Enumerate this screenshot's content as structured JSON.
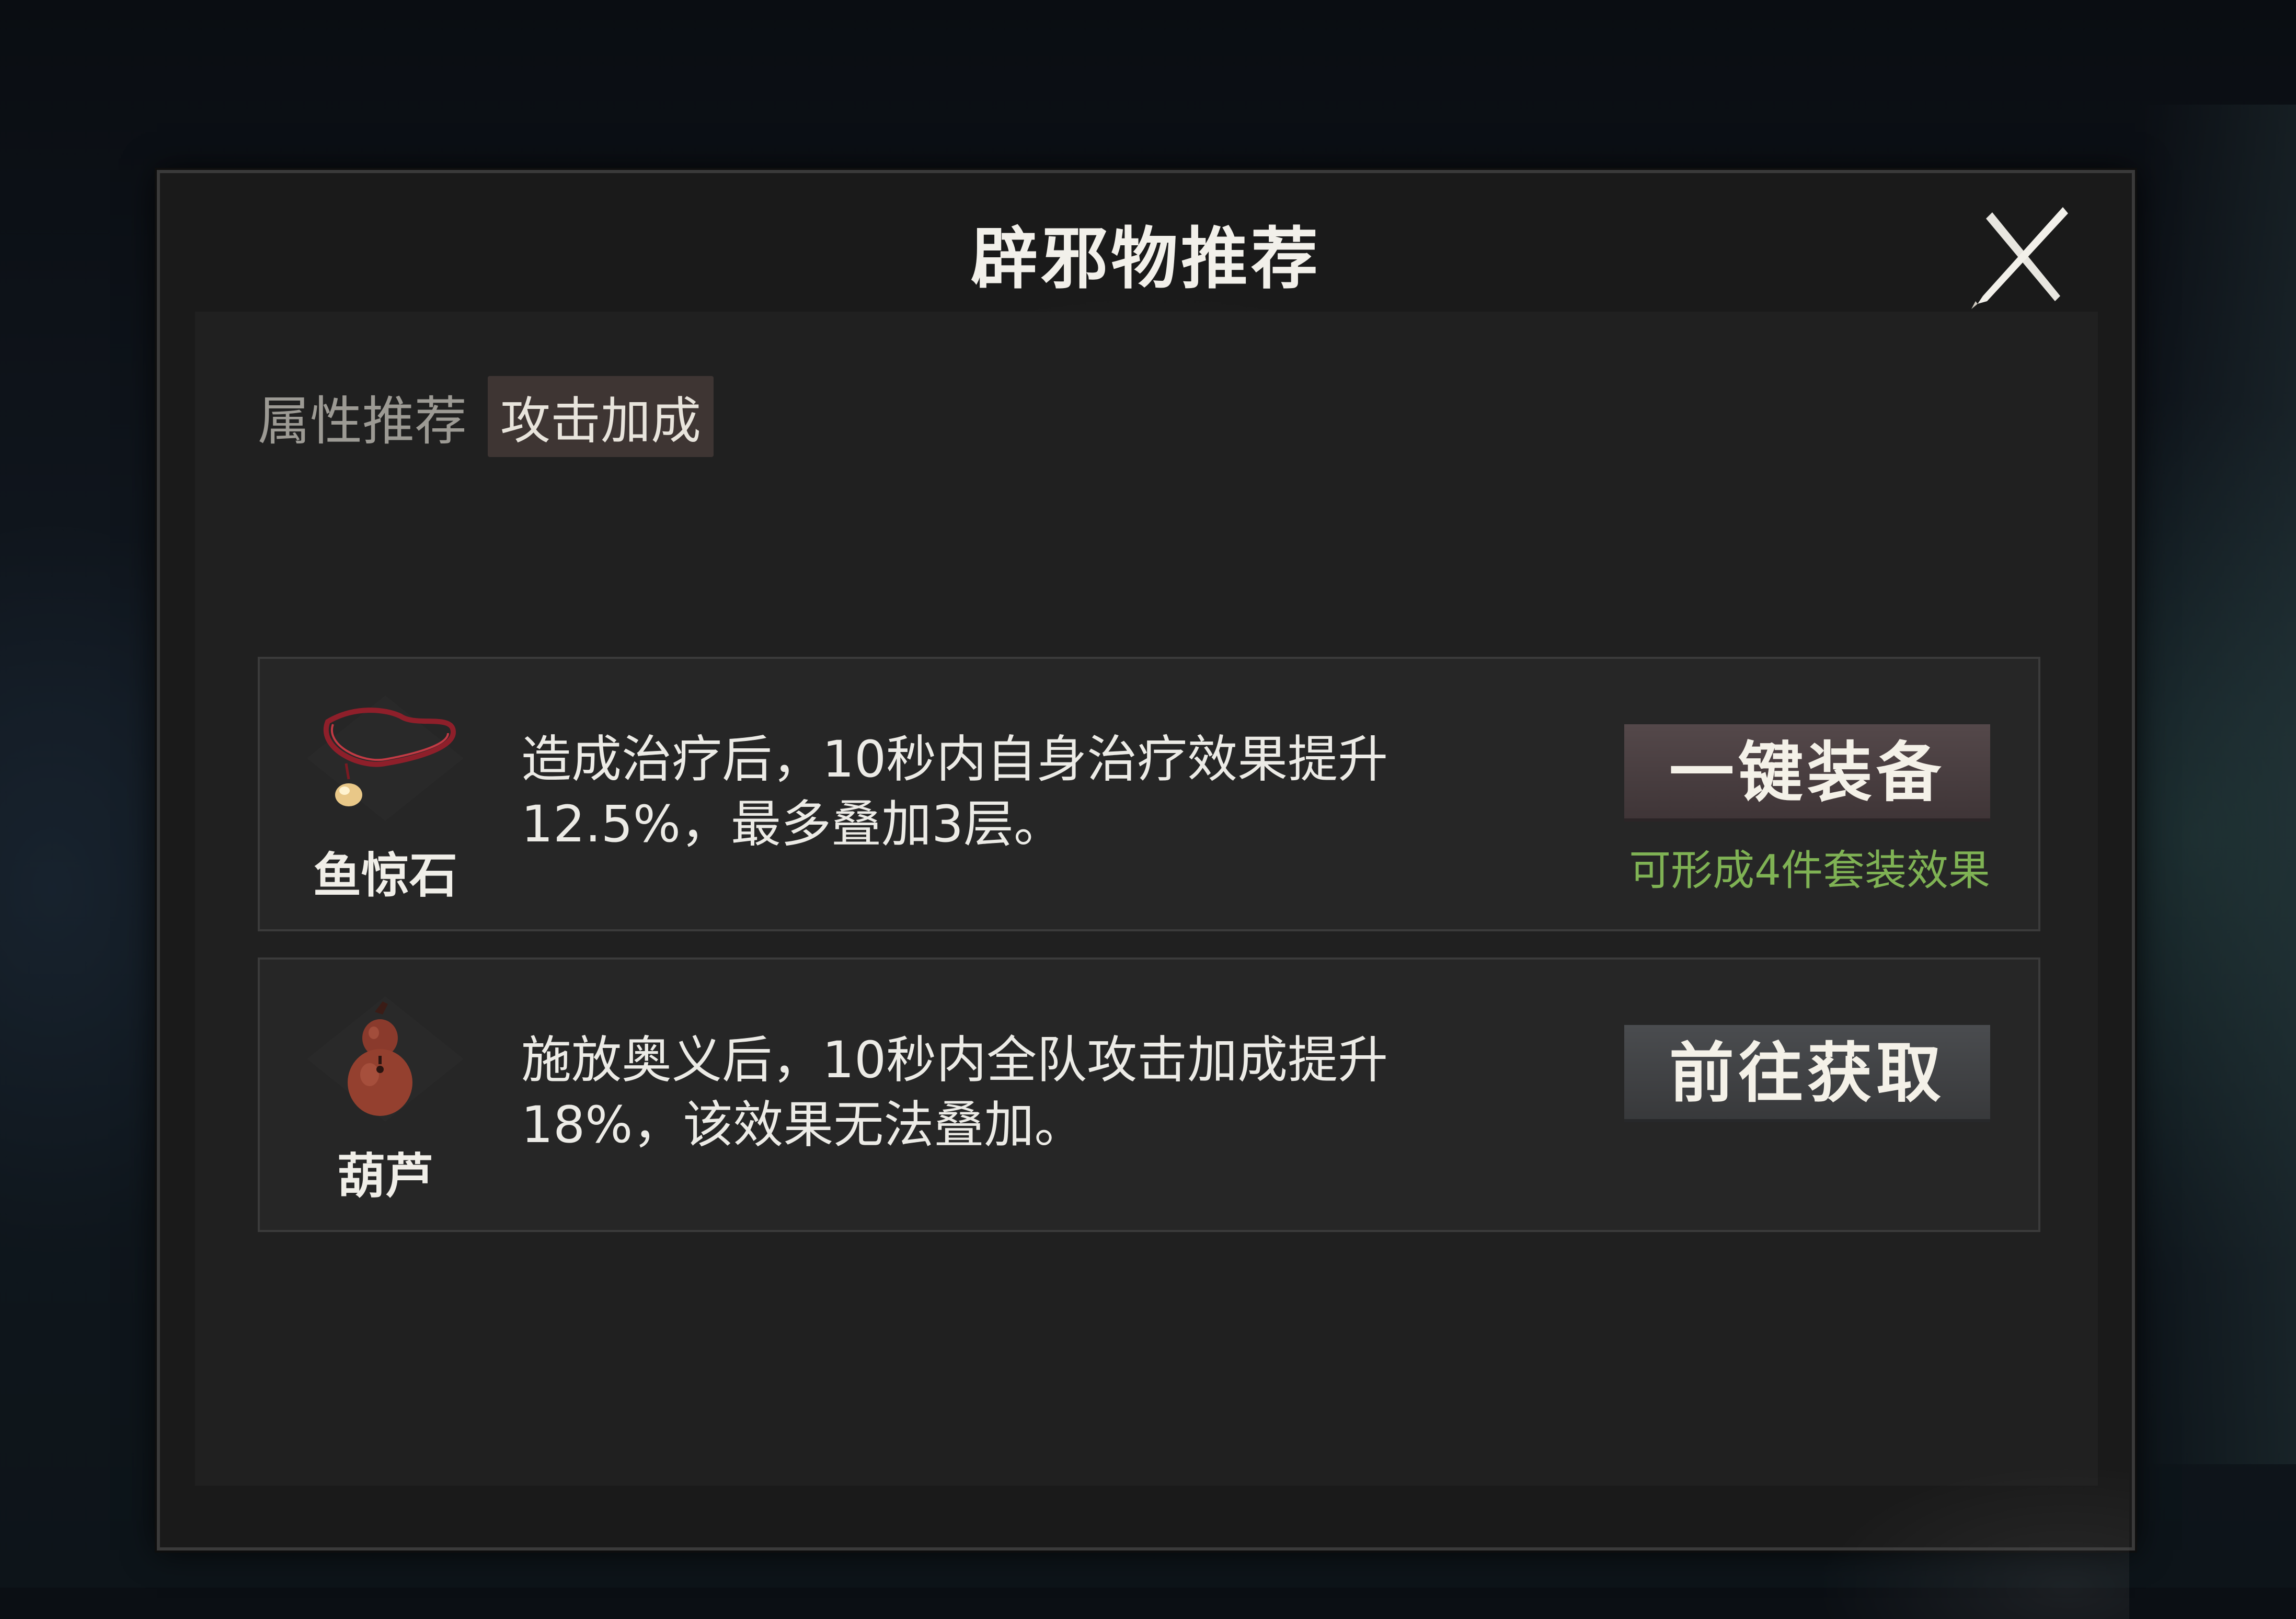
{
  "dialog": {
    "title": "辟邪物推荐",
    "close_icon": "close-x-icon"
  },
  "attribute": {
    "label": "属性推荐",
    "tag": "攻击加成"
  },
  "items": [
    {
      "name": "鱼惊石",
      "icon": "necklace-pendant-icon",
      "description_line1": "造成治疗后，10秒内自身治疗效果提升",
      "description_line2": "12.5%，最多叠加3层。",
      "button_label": "一键装备",
      "set_note": "可形成4件套装效果"
    },
    {
      "name": "葫芦",
      "icon": "gourd-icon",
      "description_line1": "施放奥义后，10秒内全队攻击加成提升",
      "description_line2": "18%，该效果无法叠加。",
      "button_label": "前往获取"
    }
  ],
  "colors": {
    "set_note": "#7fb254",
    "equip_button": "#4a3f41",
    "obtain_button": "#414345",
    "tag_bg": "#3e3533"
  }
}
